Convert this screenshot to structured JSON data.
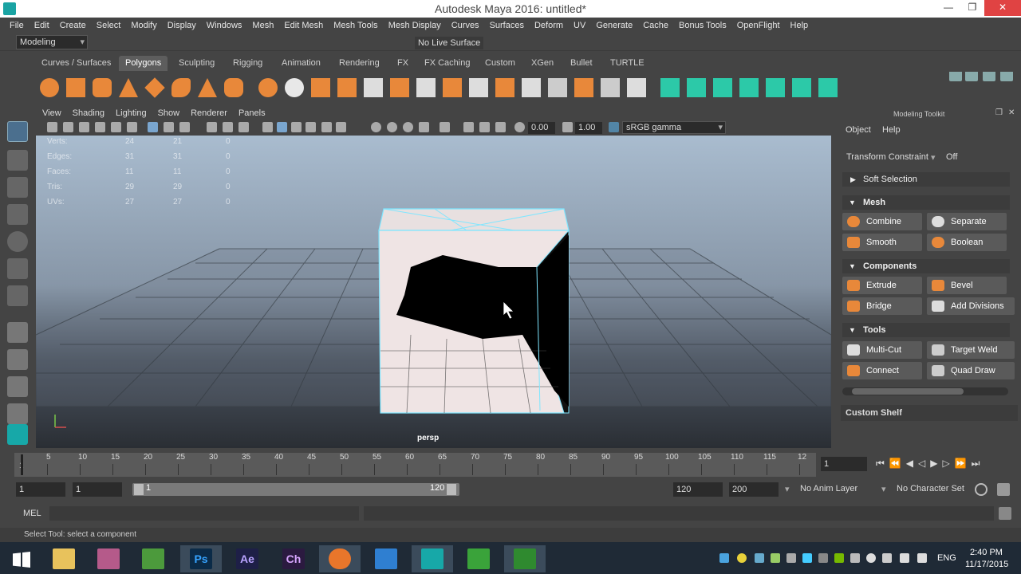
{
  "window": {
    "title": "Autodesk Maya 2016: untitled*",
    "min": "—",
    "max": "❐",
    "close": "✕"
  },
  "menubar": [
    "File",
    "Edit",
    "Create",
    "Select",
    "Modify",
    "Display",
    "Windows",
    "Mesh",
    "Edit Mesh",
    "Mesh Tools",
    "Mesh Display",
    "Curves",
    "Surfaces",
    "Deform",
    "UV",
    "Generate",
    "Cache",
    "Bonus Tools",
    "OpenFlight",
    "Help"
  ],
  "statusline": {
    "menuset": "Modeling",
    "live_surface": "No Live Surface"
  },
  "shelf_tabs": [
    "Curves / Surfaces",
    "Polygons",
    "Sculpting",
    "Rigging",
    "Animation",
    "Rendering",
    "FX",
    "FX Caching",
    "Custom",
    "XGen",
    "Bullet",
    "TURTLE"
  ],
  "active_shelf": "Polygons",
  "viewport": {
    "menu": [
      "View",
      "Shading",
      "Lighting",
      "Show",
      "Renderer",
      "Panels"
    ],
    "exposure": "0.00",
    "gamma": "1.00",
    "colorspace": "sRGB gamma",
    "camera_label": "persp",
    "hud": [
      {
        "label": "Verts:",
        "a": "24",
        "b": "21",
        "c": "0"
      },
      {
        "label": "Edges:",
        "a": "31",
        "b": "31",
        "c": "0"
      },
      {
        "label": "Faces:",
        "a": "11",
        "b": "11",
        "c": "0"
      },
      {
        "label": "Tris:",
        "a": "29",
        "b": "29",
        "c": "0"
      },
      {
        "label": "UVs:",
        "a": "27",
        "b": "27",
        "c": "0"
      }
    ]
  },
  "modeling_toolkit": {
    "title": "Modeling Toolkit",
    "menu": [
      "Object",
      "Help"
    ],
    "transform_constraint_label": "Transform Constraint",
    "transform_constraint_value": "Off",
    "soft_selection": "Soft Selection",
    "sections": {
      "mesh": {
        "title": "Mesh",
        "buttons": [
          "Combine",
          "Separate",
          "Smooth",
          "Boolean"
        ]
      },
      "components": {
        "title": "Components",
        "buttons": [
          "Extrude",
          "Bevel",
          "Bridge",
          "Add Divisions"
        ]
      },
      "tools": {
        "title": "Tools",
        "buttons": [
          "Multi-Cut",
          "Target Weld",
          "Connect",
          "Quad Draw"
        ]
      }
    },
    "custom_shelf": "Custom Shelf"
  },
  "timeline": {
    "ticks": [
      "5",
      "10",
      "15",
      "20",
      "25",
      "30",
      "35",
      "40",
      "45",
      "50",
      "55",
      "60",
      "65",
      "70",
      "75",
      "80",
      "85",
      "90",
      "95",
      "100",
      "105",
      "110",
      "115",
      "12"
    ],
    "first_tick": "1",
    "current_frame": "1"
  },
  "range": {
    "start": "1",
    "playback_start": "1",
    "slider_start": "1",
    "slider_end": "120",
    "playback_end": "120",
    "end": "200",
    "anim_layer": "No Anim Layer",
    "character_set": "No Character Set"
  },
  "command_line": {
    "label": "MEL"
  },
  "help_line": "Select Tool: select a component",
  "taskbar": {
    "apps": [
      "Ps",
      "Ae",
      "Ch"
    ],
    "language": "ENG",
    "time": "2:40 PM",
    "date": "11/17/2015"
  },
  "colors": {
    "maya_bg": "#444444",
    "accent_blue": "#5285a6",
    "wire_cyan": "#7fe6ff",
    "mesh_face": "#f2e6e6"
  }
}
